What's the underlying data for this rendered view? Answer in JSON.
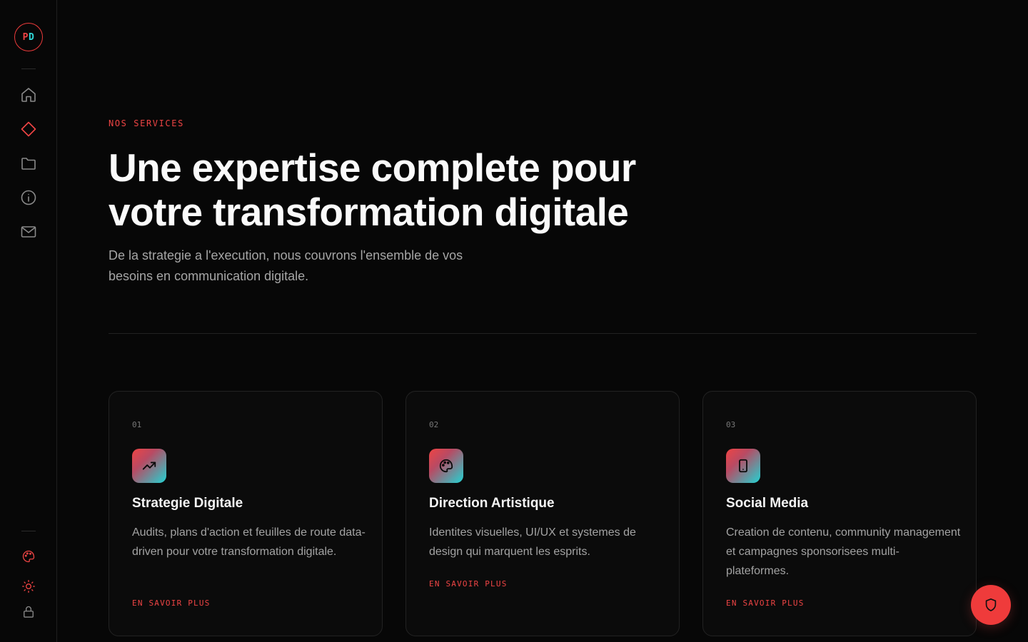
{
  "sidebar": {
    "logo": {
      "left": "P",
      "right": "D"
    },
    "nav": [
      {
        "name": "home-icon",
        "label": "home"
      },
      {
        "name": "diamond-icon",
        "label": "services",
        "active": true
      },
      {
        "name": "folder-icon",
        "label": "projects"
      },
      {
        "name": "info-icon",
        "label": "about"
      },
      {
        "name": "mail-icon",
        "label": "contact"
      }
    ],
    "bottom": [
      {
        "name": "palette-icon",
        "label": "theme"
      },
      {
        "name": "sun-icon",
        "label": "light-mode"
      },
      {
        "name": "lock-icon",
        "label": "admin"
      }
    ]
  },
  "hero": {
    "eyebrow": "NOS SERVICES",
    "heading": "Une expertise complete pour votre transformation digitale",
    "subtitle": "De la strategie a l'execution, nous couvrons l'ensemble de vos besoins en communication digitale."
  },
  "cards": [
    {
      "number": "01",
      "icon": "trending-up-icon",
      "title": "Strategie Digitale",
      "description": "Audits, plans d'action et feuilles de route data-driven pour votre transformation digitale.",
      "link": "EN SAVOIR PLUS"
    },
    {
      "number": "02",
      "icon": "palette-icon",
      "title": "Direction Artistique",
      "description": "Identites visuelles, UI/UX et systemes de design qui marquent les esprits.",
      "link": "EN SAVOIR PLUS"
    },
    {
      "number": "03",
      "icon": "smartphone-icon",
      "title": "Social Media",
      "description": "Creation de contenu, community management et campagnes sponsorisees multi-plateformes.",
      "link": "EN SAVOIR PLUS"
    }
  ],
  "fab": {
    "icon": "shield-icon"
  },
  "colors": {
    "accent": "#ef4444",
    "accent_secondary": "#22d3d3",
    "background": "#070707"
  }
}
